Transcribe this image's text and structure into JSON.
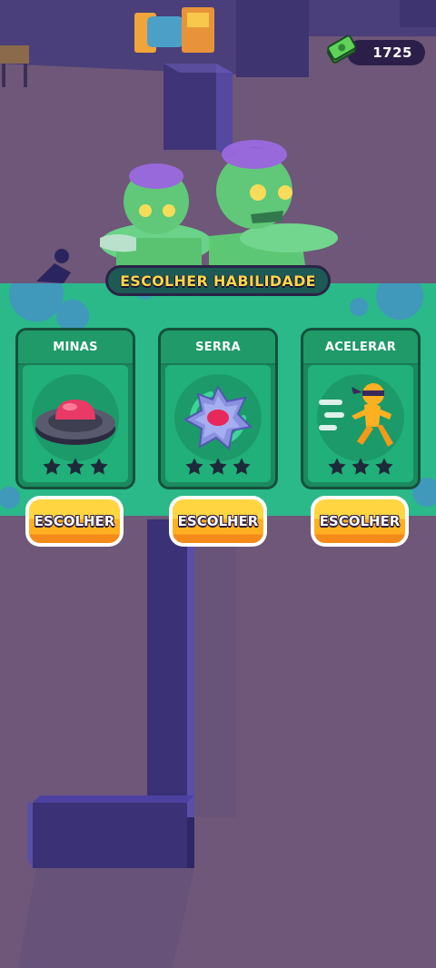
{
  "hud": {
    "currency_value": "1725",
    "currency_icon": "cash-stack-icon"
  },
  "ability_panel": {
    "title": "ESCOLHER HABILIDADE",
    "cards": [
      {
        "name": "MINAS",
        "icon": "landmine-icon",
        "stars": 3,
        "button": "ESCOLHER"
      },
      {
        "name": "SERRA",
        "icon": "saw-blade-icon",
        "stars": 3,
        "button": "ESCOLHER"
      },
      {
        "name": "ACELERAR",
        "icon": "running-ninja-icon",
        "stars": 3,
        "button": "ESCOLHER"
      }
    ]
  },
  "colors": {
    "banner": "#2bb98a",
    "title_text": "#ffd64a",
    "button": "#ffb020",
    "zombie": "#5fd66a"
  }
}
